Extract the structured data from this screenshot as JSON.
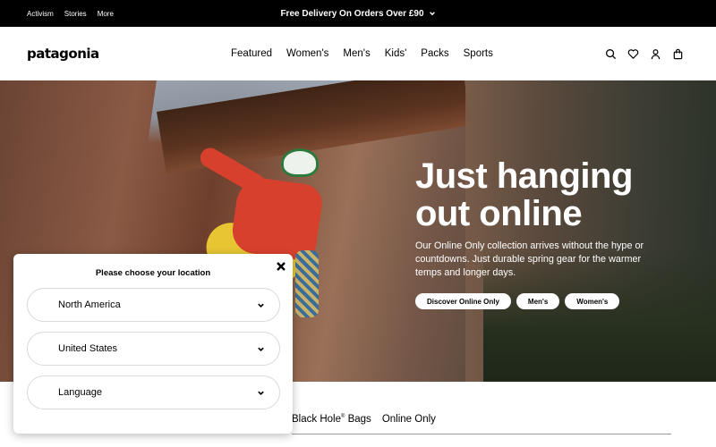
{
  "topbar": {
    "links": [
      "Activism",
      "Stories",
      "More"
    ],
    "promo": "Free Delivery On Orders Over £90",
    "promo_icon": "chevron-down-icon"
  },
  "header": {
    "logo": "patagonia",
    "nav": [
      "Featured",
      "Women's",
      "Men's",
      "Kids'",
      "Packs",
      "Sports"
    ],
    "icons": [
      "search-icon",
      "heart-icon",
      "account-icon",
      "bag-icon"
    ]
  },
  "hero": {
    "title_line1": "Just hanging",
    "title_line2": "out online",
    "body": "Our Online Only collection arrives without the hype or countdowns. Just durable spring gear for the warmer temps and longer days.",
    "ctas": [
      "Discover Online Only",
      "Men's",
      "Women's"
    ]
  },
  "tabs": {
    "black_hole": "Black Hole",
    "registered": "®",
    "black_hole_suffix": " Bags",
    "online_only": "Online Only"
  },
  "location_modal": {
    "title": "Please choose your location",
    "region": "North America",
    "country": "United States",
    "language": "Language"
  },
  "colors": {
    "topbar_bg": "#000000",
    "page_bg": "#ffffff",
    "text": "#000000"
  }
}
